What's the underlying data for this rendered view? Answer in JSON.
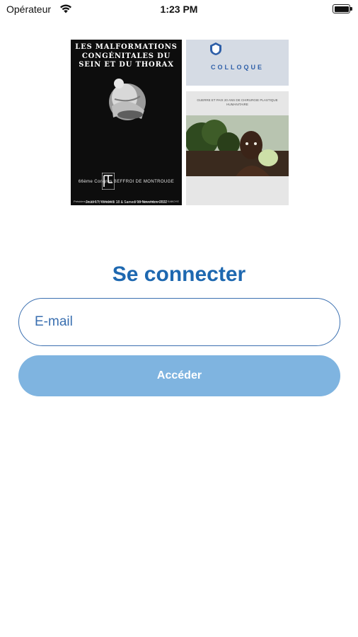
{
  "status_bar": {
    "carrier": "Opérateur",
    "time": "1:23 PM"
  },
  "posters": {
    "left": {
      "title": "LES MALFORMATIONS CONGÉNITALES DU SEIN ET DU THORAX",
      "congress": "66ème Congrès BEFFROI DE MONTROUGE",
      "dates": "Jeudi 17, Vendredi 18 & Samedi 19 Novembre 2022",
      "footer_left": "Président Dr S. de MORTILLET",
      "footer_right": "Secrétaire Général Dr J. SABOYE"
    },
    "top_right": {
      "heading": "COLLOQUE"
    },
    "bottom_right": {
      "heading": "GUERRE ET PAIX 20 ANS DE CHIRURGIE PLASTIQUE HUMANITAIRE"
    }
  },
  "login": {
    "title": "Se connecter",
    "email_placeholder": "E-mail",
    "email_value": "",
    "submit_label": "Accéder"
  },
  "colors": {
    "accent": "#1e68b0",
    "button_bg": "#7fb4e0",
    "field_border": "#3a6fb0"
  }
}
